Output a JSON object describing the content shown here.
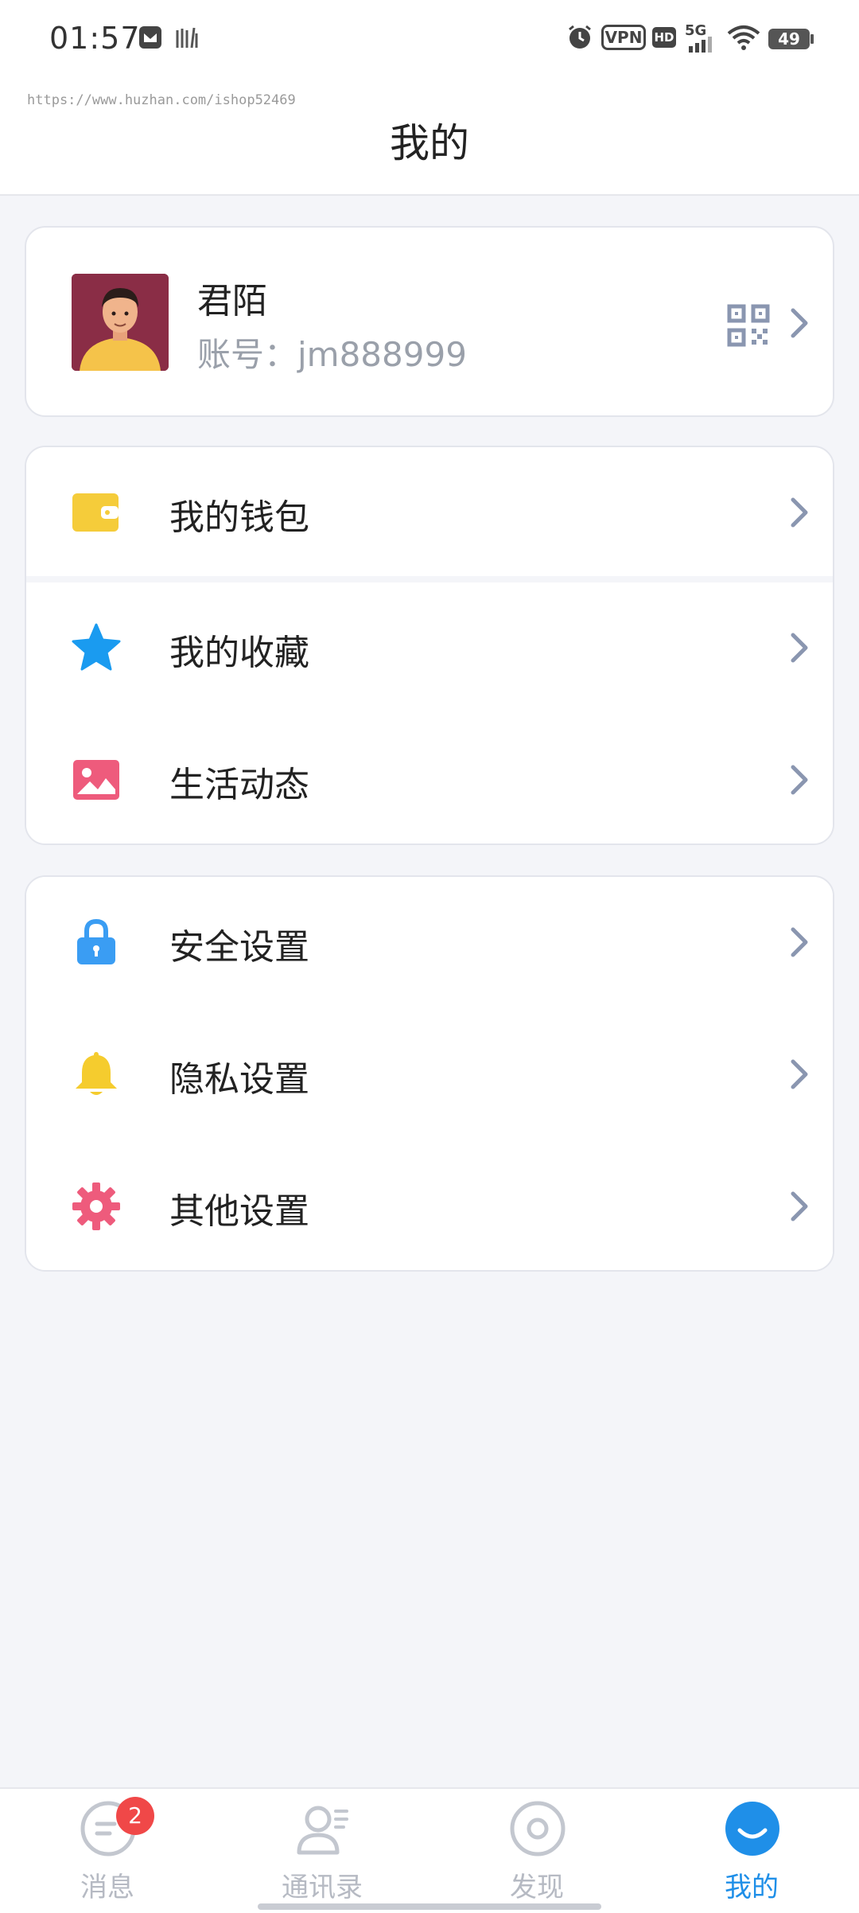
{
  "status_bar": {
    "time": "01:57",
    "vpn_label": "VPN",
    "hd_label": "HD",
    "network_label": "5G",
    "battery_level": "49",
    "icons": [
      "app-notification-icon",
      "alarm-icon",
      "signal-icon",
      "wifi-icon",
      "battery-icon"
    ]
  },
  "watermark": "https://www.huzhan.com/ishop52469",
  "header": {
    "title": "我的"
  },
  "profile": {
    "name": "君陌",
    "account": "账号：jm888999",
    "icons": [
      "avatar",
      "qr-code-icon",
      "chevron-right-icon"
    ]
  },
  "menu_group_1": [
    {
      "label": "我的钱包",
      "icon": "wallet-icon",
      "color": "#f5cc3a"
    },
    {
      "label": "我的收藏",
      "icon": "star-icon",
      "color": "#1a9bf0"
    },
    {
      "label": "生活动态",
      "icon": "image-icon",
      "color": "#ee5b7c"
    }
  ],
  "menu_group_2": [
    {
      "label": "安全设置",
      "icon": "lock-icon",
      "color": "#3a9df3"
    },
    {
      "label": "隐私设置",
      "icon": "bell-icon",
      "color": "#f5cc2e"
    },
    {
      "label": "其他设置",
      "icon": "gear-icon",
      "color": "#ee5b7c"
    }
  ],
  "bottom_nav": [
    {
      "label": "消息",
      "icon": "message-icon",
      "badge": "2",
      "active": false
    },
    {
      "label": "通讯录",
      "icon": "contacts-icon",
      "active": false
    },
    {
      "label": "发现",
      "icon": "discover-icon",
      "active": false
    },
    {
      "label": "我的",
      "icon": "me-icon",
      "active": true
    }
  ],
  "colors": {
    "accent": "#1f8fe8",
    "background": "#f4f5f9",
    "badge": "#f04848",
    "chevron": "#8a96b0"
  }
}
